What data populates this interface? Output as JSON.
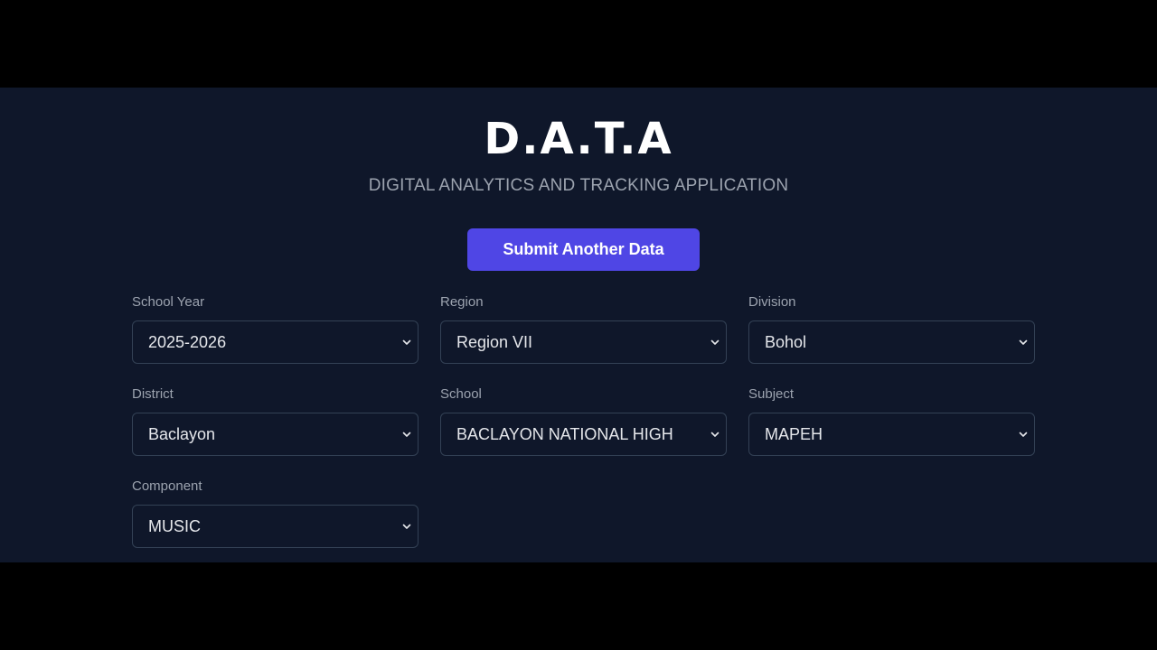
{
  "header": {
    "title": "D.A.T.A",
    "subtitle": "DIGITAL ANALYTICS AND TRACKING APPLICATION"
  },
  "actions": {
    "submit_label": "Submit Another Data"
  },
  "form": {
    "school_year": {
      "label": "School Year",
      "value": "2025-2026"
    },
    "region": {
      "label": "Region",
      "value": "Region VII"
    },
    "division": {
      "label": "Division",
      "value": "Bohol"
    },
    "district": {
      "label": "District",
      "value": "Baclayon"
    },
    "school": {
      "label": "School",
      "value": "BACLAYON NATIONAL HIGH"
    },
    "subject": {
      "label": "Subject",
      "value": "MAPEH"
    },
    "component": {
      "label": "Component",
      "value": "MUSIC"
    }
  },
  "icons": {
    "dropdown": "chevron-down-icon"
  },
  "colors": {
    "background": "#0f172a",
    "letterbox": "#000000",
    "accent": "#4f46e5",
    "border": "#334155",
    "muted_text": "#9ca3af"
  }
}
